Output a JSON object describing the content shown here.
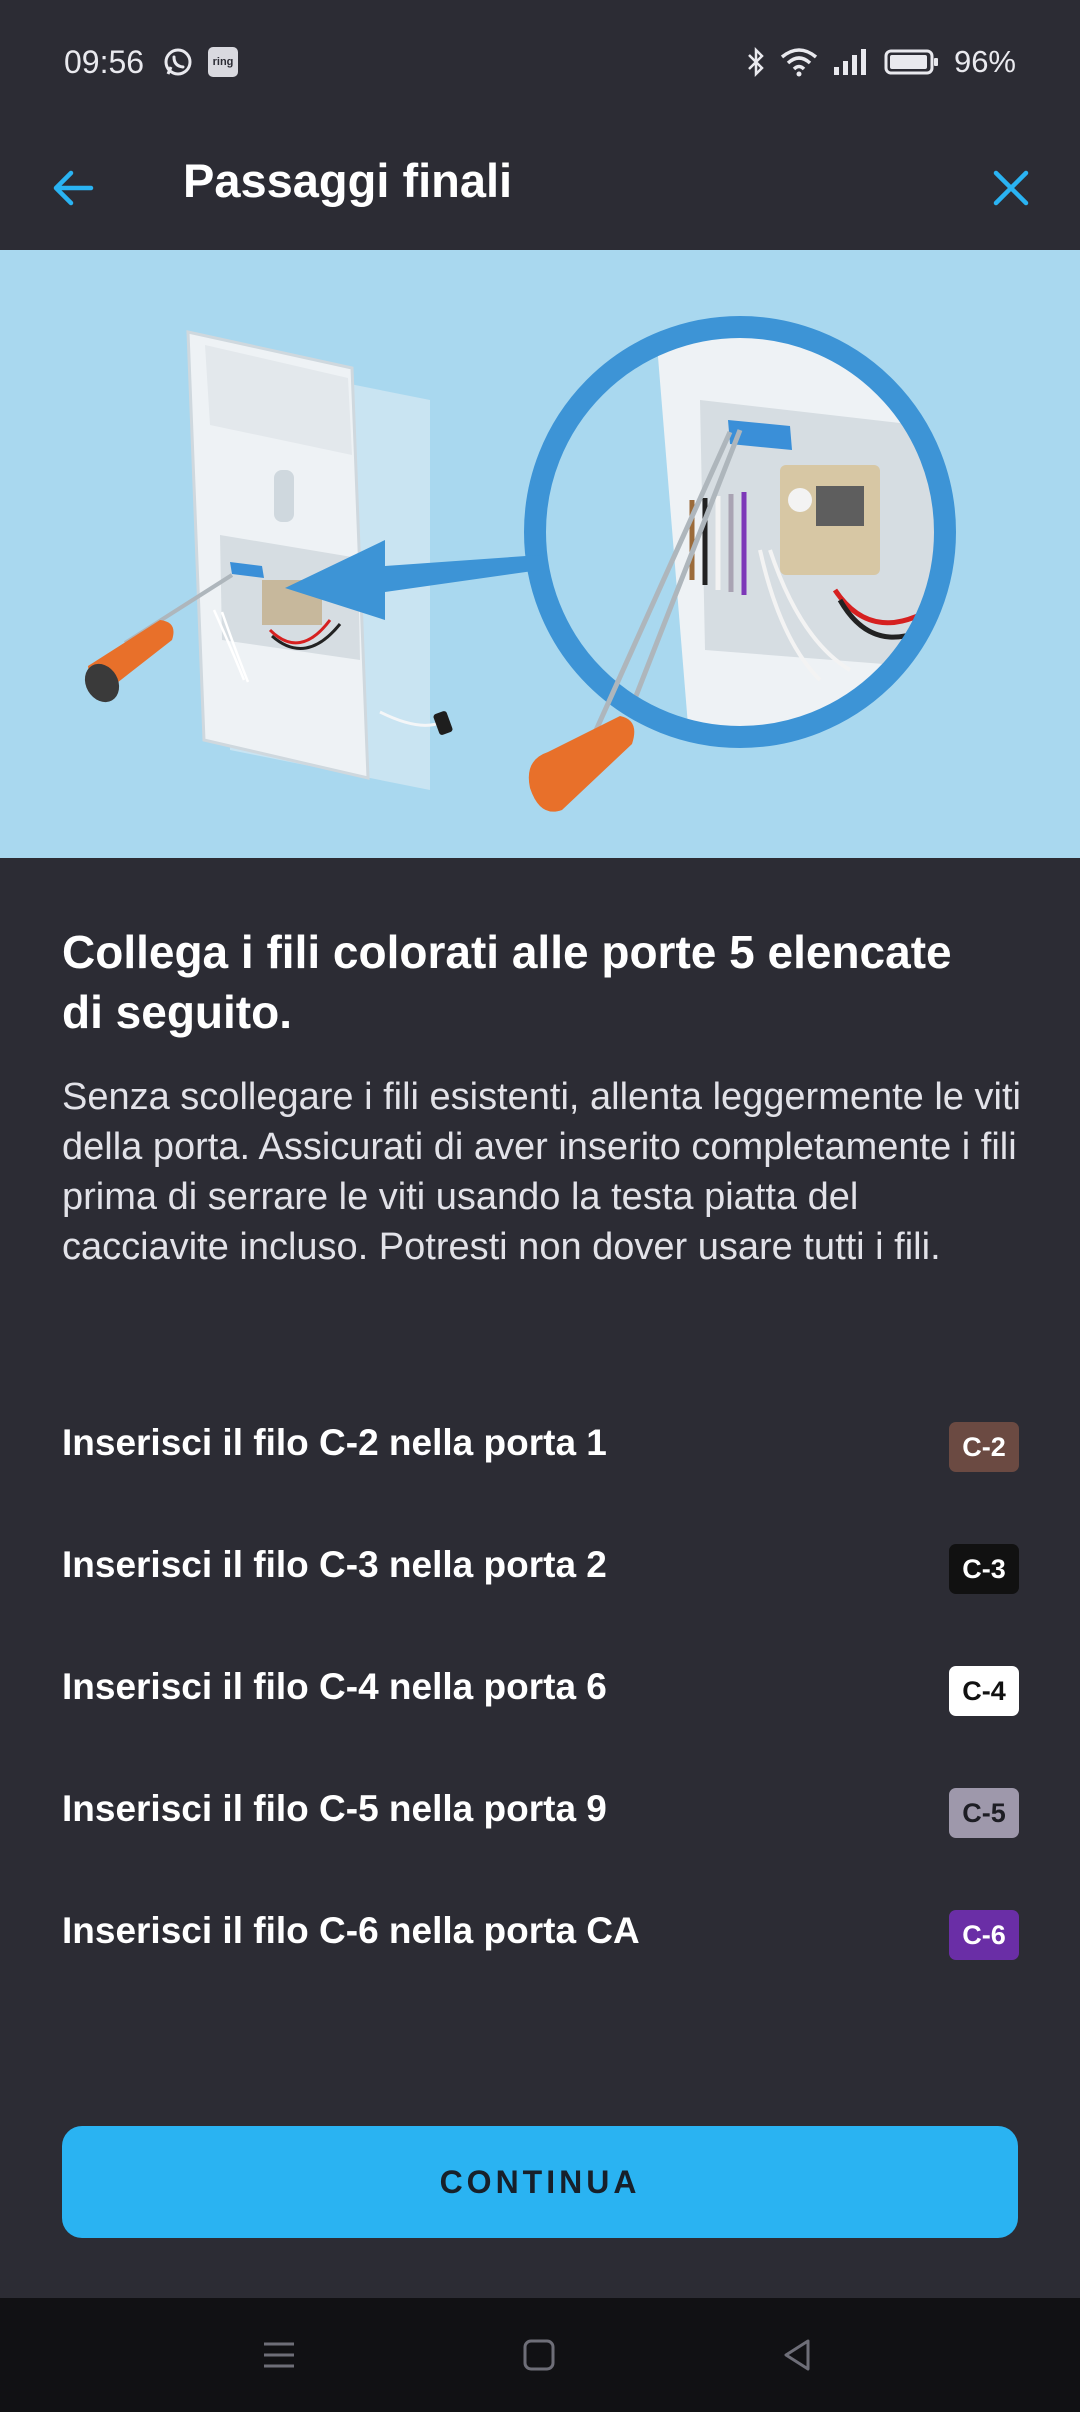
{
  "status_bar": {
    "time": "09:56",
    "left_icons": [
      "whatsapp-icon",
      "ring-icon"
    ],
    "ring_badge": "ring",
    "battery": "96%"
  },
  "header": {
    "title": "Passaggi finali",
    "back_icon": "arrow-left-icon",
    "close_icon": "close-icon"
  },
  "instructions": {
    "heading": "Collega i fili colorati alle porte 5 elencate di seguito.",
    "body": "Senza scollegare i fili esistenti, allenta leggermente le viti della porta. Assicurati di aver inserito completamente i fili prima di serrare le viti usando la testa piatta del cacciavite incluso. Potresti non dover usare tutti i fili."
  },
  "wires": [
    {
      "label": "Inserisci il filo C-2 nella porta 1",
      "badge": "C-2",
      "badge_bg": "#6b4a42",
      "badge_fg": "#ffffff"
    },
    {
      "label": "Inserisci il filo C-3 nella porta 2",
      "badge": "C-3",
      "badge_bg": "#111111",
      "badge_fg": "#ffffff"
    },
    {
      "label": "Inserisci il filo C-4 nella porta 6",
      "badge": "C-4",
      "badge_bg": "#ffffff",
      "badge_fg": "#111111"
    },
    {
      "label": "Inserisci il filo C-5 nella porta 9",
      "badge": "C-5",
      "badge_bg": "#9e98ab",
      "badge_fg": "#1d1d24"
    },
    {
      "label": "Inserisci il filo C-6 nella porta CA",
      "badge": "C-6",
      "badge_bg": "#6a2ea6",
      "badge_fg": "#ffffff"
    }
  ],
  "actions": {
    "continue_label": "CONTINUA"
  },
  "colors": {
    "background": "#2c2c34",
    "accent": "#2ab3f2",
    "hero_bg": "#a9d8ef",
    "screwdriver_orange": "#e8702a"
  }
}
